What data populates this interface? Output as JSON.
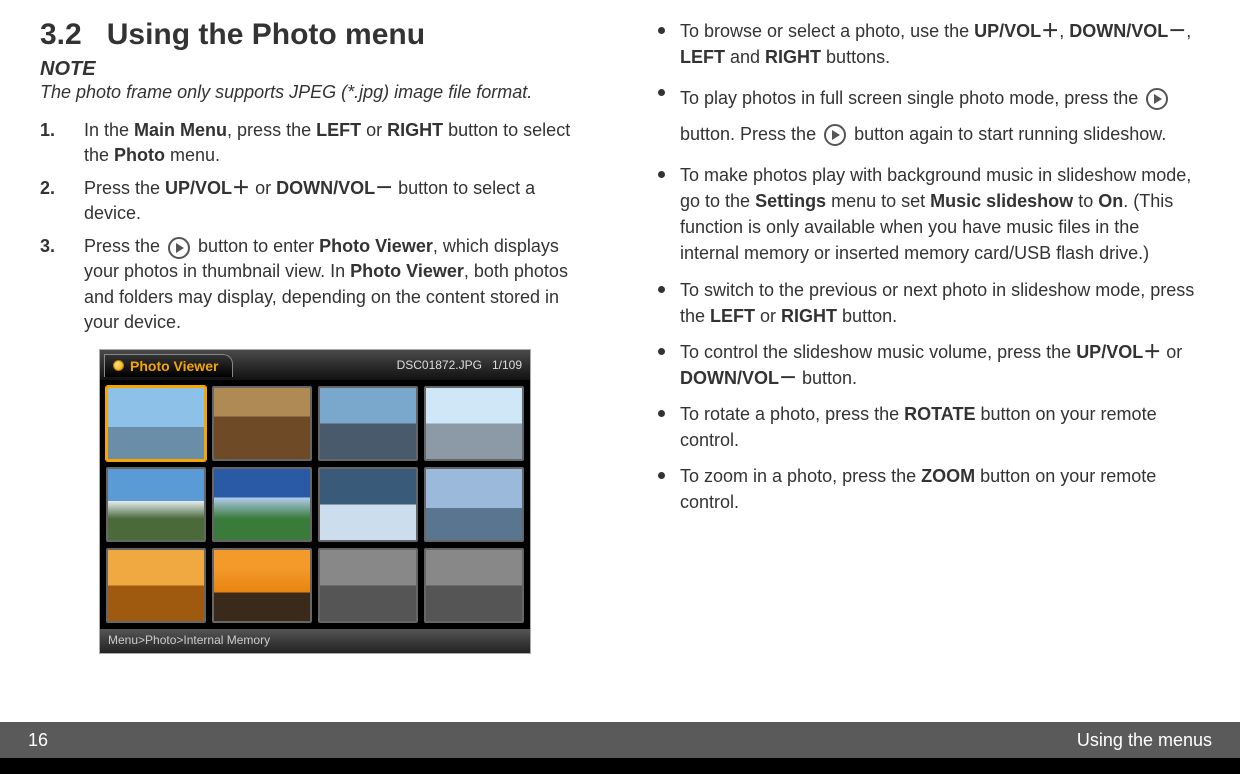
{
  "section": {
    "number": "3.2",
    "title": "Using the Photo menu"
  },
  "note": {
    "label": "NOTE",
    "text": "The photo frame only supports JPEG (*.jpg) image file format."
  },
  "steps": {
    "s1": {
      "pre": "In the ",
      "b1": "Main Menu",
      "mid1": ", press the ",
      "b2": "LEFT",
      "mid2": " or ",
      "b3": "RIGHT",
      "mid3": " button to select the ",
      "b4": "Photo",
      "post": " menu."
    },
    "s2": {
      "pre": "Press the ",
      "b1": "UP/VOL＋",
      "mid1": " or ",
      "b2": "DOWN/VOL－",
      "post": " button to select a device."
    },
    "s3": {
      "pre": "Press the ",
      "mid1": " button to enter ",
      "b1": "Photo Viewer",
      "mid2": ", which displays your photos in thumbnail view. In ",
      "b2": "Photo Viewer",
      "post": ", both photos and folders may display, depending on the content stored in your device."
    }
  },
  "photoViewer": {
    "title": "Photo Viewer",
    "filename": "DSC01872.JPG",
    "count": "1/109",
    "breadcrumb": "Menu>Photo>Internal Memory"
  },
  "bullets": {
    "b1": {
      "pre": "To browse or select a photo, use the ",
      "k1": "UP/VOL＋",
      "c1": ", ",
      "k2": "DOWN/VOL－",
      "c2": ", ",
      "k3": "LEFT",
      "c3": " and ",
      "k4": "RIGHT",
      "post": " buttons."
    },
    "b2": {
      "pre": "To play photos in full screen single photo mode, press the ",
      "mid": " button. Press the ",
      "post": " button again to start running slideshow."
    },
    "b3": {
      "pre": "To make photos play with background music in slideshow mode, go to the ",
      "k1": "Settings",
      "mid1": " menu to set ",
      "k2": "Music slideshow",
      "mid2": " to ",
      "k3": "On",
      "post": ". (This function is only available when you have music files in the internal memory or inserted memory card/USB flash drive.)"
    },
    "b4": {
      "pre": "To switch to the previous or next photo in slideshow mode, press the ",
      "k1": "LEFT",
      "mid": " or ",
      "k2": "RIGHT",
      "post": " button."
    },
    "b5": {
      "pre": "To control the slideshow music volume, press the ",
      "k1": "UP/VOL＋",
      "mid": " or ",
      "k2": "DOWN/VOL－",
      "post": " button."
    },
    "b6": {
      "pre": "To rotate a photo, press the ",
      "k1": "ROTATE",
      "post": " button on your remote control."
    },
    "b7": {
      "pre": "To zoom in a photo, press the ",
      "k1": "ZOOM",
      "post": " button on your remote control."
    }
  },
  "footer": {
    "page": "16",
    "chapter": "Using the menus"
  },
  "thumbs": [
    "linear-gradient(180deg,#8ec1e8 55%,#6b8ea8 55%)",
    "linear-gradient(180deg,#b08a54 40%,#6e4a27 40%)",
    "linear-gradient(180deg,#7aa7cc 50%,#4a5a6d 50%)",
    "linear-gradient(180deg,#cfe7f6 50%,#8b9aa6 50%)",
    "linear-gradient(180deg,#5a9bd6 45%,#e8eef3 45%,#4a6a3a 70%)",
    "linear-gradient(180deg,#2a5aa6 40%,#b3cdee 40%,#3a7a3a 70%)",
    "linear-gradient(180deg,#3a5a7a 50%,#cde 50%)",
    "linear-gradient(180deg,#9bbadb 55%,#5a7590 55%)",
    "linear-gradient(180deg,#f0a840 50%,#a05a10 50%)",
    "linear-gradient(180deg,#f39a2a 25%,#e88410 60%,#3a2a1a 60%)",
    "linear-gradient(180deg,#888 50%,#555 50%)",
    "linear-gradient(180deg,#888 50%,#555 50%)"
  ]
}
